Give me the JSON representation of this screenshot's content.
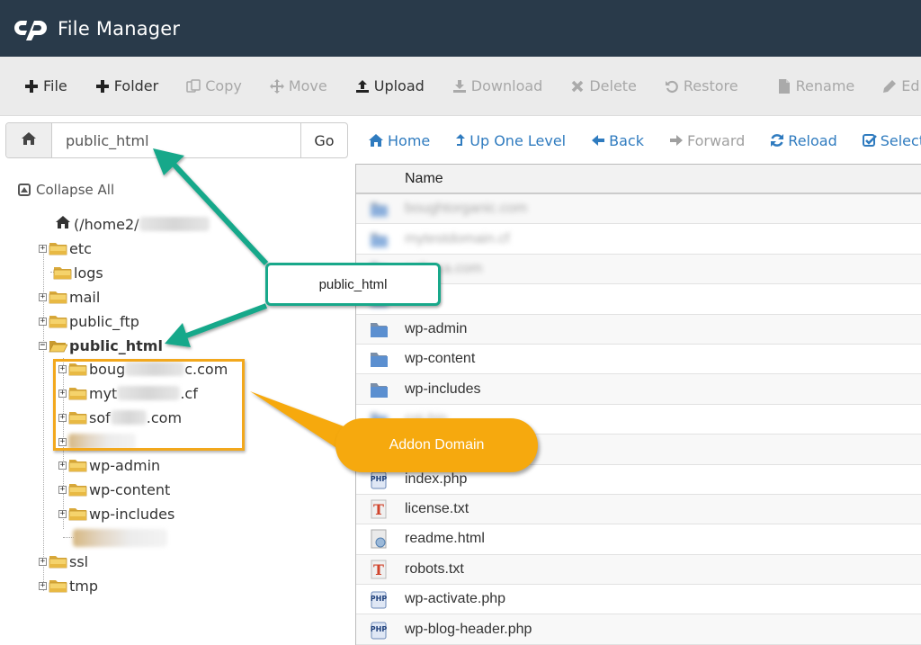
{
  "header": {
    "title": "File Manager",
    "logo": "cpanel-logo"
  },
  "toolbar": {
    "items": [
      {
        "label": "File",
        "icon": "plus-icon",
        "enabled": true
      },
      {
        "label": "Folder",
        "icon": "plus-icon",
        "enabled": true
      },
      {
        "label": "Copy",
        "icon": "copy-icon",
        "enabled": false
      },
      {
        "label": "Move",
        "icon": "move-icon",
        "enabled": false
      },
      {
        "label": "Upload",
        "icon": "upload-icon",
        "enabled": true
      },
      {
        "label": "Download",
        "icon": "download-icon",
        "enabled": false
      },
      {
        "label": "Delete",
        "icon": "x-icon",
        "enabled": false
      },
      {
        "label": "Restore",
        "icon": "undo-icon",
        "enabled": false
      },
      {
        "label": "Rename",
        "icon": "file-icon",
        "enabled": false
      },
      {
        "label": "Edit",
        "icon": "pencil-icon",
        "enabled": false
      }
    ]
  },
  "pathbar": {
    "value": "public_html",
    "go_label": "Go"
  },
  "tree": {
    "collapse_label": "Collapse All",
    "root_label": "(/home2/",
    "nodes": [
      {
        "label": "etc"
      },
      {
        "label": "logs"
      },
      {
        "label": "mail"
      },
      {
        "label": "public_ftp"
      },
      {
        "label": "public_html"
      },
      {
        "label_start": "boug",
        "label_end": "c.com"
      },
      {
        "label_start": "myt",
        "label_end": ".cf"
      },
      {
        "label_start": "sof",
        "label_end": ".com"
      },
      {
        "label": ""
      },
      {
        "label": "wp-admin"
      },
      {
        "label": "wp-content"
      },
      {
        "label": "wp-includes"
      },
      {
        "label": ""
      },
      {
        "label": "ssl"
      },
      {
        "label": "tmp"
      }
    ]
  },
  "nav": {
    "items": [
      {
        "label": "Home",
        "icon": "home-icon",
        "enabled": true
      },
      {
        "label": "Up One Level",
        "icon": "level-up-icon",
        "enabled": true
      },
      {
        "label": "Back",
        "icon": "arrow-left-icon",
        "enabled": true
      },
      {
        "label": "Forward",
        "icon": "arrow-right-icon",
        "enabled": false
      },
      {
        "label": "Reload",
        "icon": "refresh-icon",
        "enabled": true
      },
      {
        "label": "Select All",
        "icon": "checkbox-icon",
        "enabled": true
      }
    ]
  },
  "files": {
    "column_name": "Name",
    "rows": [
      {
        "name": "boughtorganic.com",
        "type": "folder",
        "blurred": true
      },
      {
        "name": "mytestdomain.cf",
        "type": "folder",
        "blurred": true
      },
      {
        "name": "softeca.com",
        "type": "folder",
        "blurred": true
      },
      {
        "name": "",
        "type": "folder",
        "blurred": true
      },
      {
        "name": "wp-admin",
        "type": "folder",
        "blurred": false
      },
      {
        "name": "wp-content",
        "type": "folder",
        "blurred": false
      },
      {
        "name": "wp-includes",
        "type": "folder",
        "blurred": false
      },
      {
        "name": "cgi-bin",
        "type": "folder",
        "blurred": true
      },
      {
        "name": "",
        "type": "file",
        "blurred": true
      },
      {
        "name": "index.php",
        "type": "php",
        "blurred": false
      },
      {
        "name": "license.txt",
        "type": "txt",
        "blurred": false
      },
      {
        "name": "readme.html",
        "type": "html",
        "blurred": false
      },
      {
        "name": "robots.txt",
        "type": "txt",
        "blurred": false
      },
      {
        "name": "wp-activate.php",
        "type": "php",
        "blurred": false
      },
      {
        "name": "wp-blog-header.php",
        "type": "php",
        "blurred": false
      }
    ]
  },
  "annotations": {
    "green_callout": "public_html",
    "orange_callout": "Addon Domain",
    "colors": {
      "green": "#18a88a",
      "orange": "#f6a90e",
      "header_bg": "#293a4a",
      "link_blue": "#2f7bbf"
    }
  }
}
